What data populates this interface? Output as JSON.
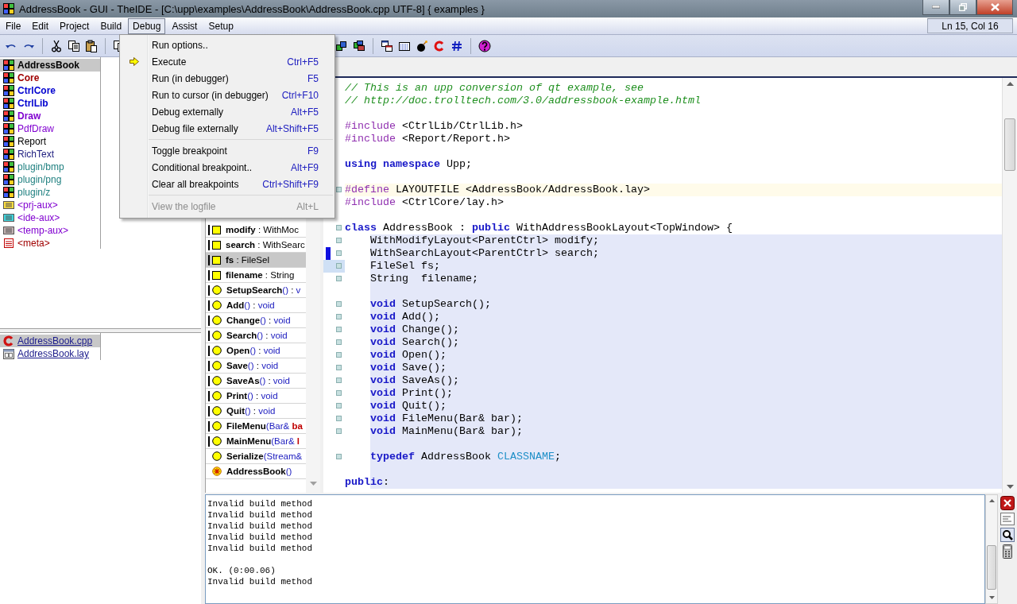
{
  "window": {
    "title": "AddressBook - GUI - TheIDE - [C:\\upp\\examples\\AddressBook\\AddressBook.cpp UTF-8] { examples }"
  },
  "menu_bar": [
    {
      "label": "File",
      "selected": false
    },
    {
      "label": "Edit",
      "selected": false
    },
    {
      "label": "Project",
      "selected": false
    },
    {
      "label": "Build",
      "selected": false
    },
    {
      "label": "Debug",
      "selected": true
    },
    {
      "label": "Assist",
      "selected": false
    },
    {
      "label": "Setup",
      "selected": false
    }
  ],
  "cursor_position": "Ln 15, Col 16",
  "debug_menu": [
    {
      "kind": "item",
      "label": "Run options..",
      "disabled": false
    },
    {
      "kind": "icon_item",
      "label": "Execute",
      "shortcut": "Ctrl+F5",
      "disabled": false
    },
    {
      "kind": "item",
      "label": "Run (in debugger)",
      "shortcut": "F5",
      "disabled": false
    },
    {
      "kind": "item",
      "label": "Run to cursor (in debugger)",
      "shortcut": "Ctrl+F10",
      "disabled": false
    },
    {
      "kind": "item",
      "label": "Debug externally",
      "shortcut": "Alt+F5",
      "disabled": false
    },
    {
      "kind": "item",
      "label": "Debug file externally",
      "shortcut": "Alt+Shift+F5",
      "disabled": false
    },
    {
      "kind": "separator"
    },
    {
      "kind": "item",
      "label": "Toggle breakpoint",
      "shortcut": "F9",
      "disabled": false
    },
    {
      "kind": "item",
      "label": "Conditional breakpoint..",
      "shortcut": "Alt+F9",
      "disabled": false
    },
    {
      "kind": "item",
      "label": "Clear all breakpoints",
      "shortcut": "Ctrl+Shift+F9",
      "disabled": false
    },
    {
      "kind": "separator"
    },
    {
      "kind": "item",
      "label": "View the logfile",
      "shortcut": "Alt+L",
      "disabled": true
    }
  ],
  "packages": [
    {
      "name": "AddressBook",
      "kind": "package",
      "bold": true,
      "color": "#000000",
      "selected": true
    },
    {
      "name": "Core",
      "kind": "package",
      "bold": true,
      "color": "#a00000",
      "selected": false
    },
    {
      "name": "CtrlCore",
      "kind": "package",
      "bold": true,
      "color": "#0000d0",
      "selected": false
    },
    {
      "name": "CtrlLib",
      "kind": "package",
      "bold": true,
      "color": "#0000d0",
      "selected": false
    },
    {
      "name": "Draw",
      "kind": "package",
      "bold": true,
      "color": "#8000d0",
      "selected": false
    },
    {
      "name": "PdfDraw",
      "kind": "package",
      "bold": false,
      "color": "#8000d0",
      "selected": false
    },
    {
      "name": "Report",
      "kind": "package",
      "bold": false,
      "color": "#000000",
      "selected": false
    },
    {
      "name": "RichText",
      "kind": "package",
      "bold": false,
      "color": "#202080",
      "selected": false
    },
    {
      "name": "plugin/bmp",
      "kind": "package",
      "bold": false,
      "color": "#208080",
      "selected": false
    },
    {
      "name": "plugin/png",
      "kind": "package",
      "bold": false,
      "color": "#208080",
      "selected": false
    },
    {
      "name": "plugin/z",
      "kind": "package",
      "bold": false,
      "color": "#208080",
      "selected": false
    },
    {
      "name": "<prj-aux>",
      "kind": "prj-aux",
      "bold": false,
      "color": "#8000d0",
      "selected": false
    },
    {
      "name": "<ide-aux>",
      "kind": "ide-aux",
      "bold": false,
      "color": "#8000d0",
      "selected": false
    },
    {
      "name": "<temp-aux>",
      "kind": "temp-aux",
      "bold": false,
      "color": "#8000d0",
      "selected": false
    },
    {
      "name": "<meta>",
      "kind": "meta",
      "bold": false,
      "color": "#a00000",
      "selected": false
    }
  ],
  "files": [
    {
      "name": "AddressBook.cpp",
      "kind": "cpp",
      "selected": true
    },
    {
      "name": "AddressBook.lay",
      "kind": "lay",
      "selected": false
    }
  ],
  "navigator": [
    {
      "kind": "variable",
      "bar": true,
      "selected": false,
      "segments": [
        {
          "text": "modify",
          "kind": "name"
        },
        {
          "text": " : WithMoc",
          "kind": "plain"
        }
      ]
    },
    {
      "kind": "variable",
      "bar": true,
      "selected": false,
      "segments": [
        {
          "text": "search",
          "kind": "name"
        },
        {
          "text": " : WithSearc",
          "kind": "plain"
        }
      ]
    },
    {
      "kind": "variable",
      "bar": true,
      "selected": true,
      "segments": [
        {
          "text": "fs",
          "kind": "name"
        },
        {
          "text": " : FileSel",
          "kind": "plain"
        }
      ]
    },
    {
      "kind": "variable",
      "bar": true,
      "selected": false,
      "segments": [
        {
          "text": "filename",
          "kind": "name"
        },
        {
          "text": " : String",
          "kind": "plain"
        }
      ]
    },
    {
      "kind": "function",
      "bar": true,
      "selected": false,
      "segments": [
        {
          "text": "SetupSearch",
          "kind": "name"
        },
        {
          "text": "()",
          "kind": "sig"
        },
        {
          "text": " : ",
          "kind": "plain"
        },
        {
          "text": "v",
          "kind": "sig"
        }
      ]
    },
    {
      "kind": "function",
      "bar": true,
      "selected": false,
      "segments": [
        {
          "text": "Add",
          "kind": "name"
        },
        {
          "text": "()",
          "kind": "sig"
        },
        {
          "text": " : ",
          "kind": "plain"
        },
        {
          "text": "void",
          "kind": "sig"
        }
      ]
    },
    {
      "kind": "function",
      "bar": true,
      "selected": false,
      "segments": [
        {
          "text": "Change",
          "kind": "name"
        },
        {
          "text": "()",
          "kind": "sig"
        },
        {
          "text": " : ",
          "kind": "plain"
        },
        {
          "text": "void",
          "kind": "sig"
        }
      ]
    },
    {
      "kind": "function",
      "bar": true,
      "selected": false,
      "segments": [
        {
          "text": "Search",
          "kind": "name"
        },
        {
          "text": "()",
          "kind": "sig"
        },
        {
          "text": " : ",
          "kind": "plain"
        },
        {
          "text": "void",
          "kind": "sig"
        }
      ]
    },
    {
      "kind": "function",
      "bar": true,
      "selected": false,
      "segments": [
        {
          "text": "Open",
          "kind": "name"
        },
        {
          "text": "()",
          "kind": "sig"
        },
        {
          "text": " : ",
          "kind": "plain"
        },
        {
          "text": "void",
          "kind": "sig"
        }
      ]
    },
    {
      "kind": "function",
      "bar": true,
      "selected": false,
      "segments": [
        {
          "text": "Save",
          "kind": "name"
        },
        {
          "text": "()",
          "kind": "sig"
        },
        {
          "text": " : ",
          "kind": "plain"
        },
        {
          "text": "void",
          "kind": "sig"
        }
      ]
    },
    {
      "kind": "function",
      "bar": true,
      "selected": false,
      "segments": [
        {
          "text": "SaveAs",
          "kind": "name"
        },
        {
          "text": "()",
          "kind": "sig"
        },
        {
          "text": " : ",
          "kind": "plain"
        },
        {
          "text": "void",
          "kind": "sig"
        }
      ]
    },
    {
      "kind": "function",
      "bar": true,
      "selected": false,
      "segments": [
        {
          "text": "Print",
          "kind": "name"
        },
        {
          "text": "()",
          "kind": "sig"
        },
        {
          "text": " : ",
          "kind": "plain"
        },
        {
          "text": "void",
          "kind": "sig"
        }
      ]
    },
    {
      "kind": "function",
      "bar": true,
      "selected": false,
      "segments": [
        {
          "text": "Quit",
          "kind": "name"
        },
        {
          "text": "()",
          "kind": "sig"
        },
        {
          "text": " : ",
          "kind": "plain"
        },
        {
          "text": "void",
          "kind": "sig"
        }
      ]
    },
    {
      "kind": "function",
      "bar": true,
      "selected": false,
      "segments": [
        {
          "text": "FileMenu",
          "kind": "name"
        },
        {
          "text": "(Bar& ",
          "kind": "sig"
        },
        {
          "text": "ba",
          "kind": "arg"
        }
      ]
    },
    {
      "kind": "function",
      "bar": true,
      "selected": false,
      "segments": [
        {
          "text": "MainMenu",
          "kind": "name"
        },
        {
          "text": "(Bar& ",
          "kind": "sig"
        },
        {
          "text": "l",
          "kind": "arg"
        }
      ]
    },
    {
      "kind": "function",
      "bar": false,
      "selected": false,
      "segments": [
        {
          "text": "Serialize",
          "kind": "name"
        },
        {
          "text": "(Stream&",
          "kind": "sig"
        }
      ]
    },
    {
      "kind": "constructor",
      "bar": false,
      "selected": false,
      "segments": [
        {
          "text": "AddressBook",
          "kind": "name"
        },
        {
          "text": "()",
          "kind": "sig"
        }
      ]
    }
  ],
  "editor": {
    "lines": [
      {
        "kind": "plain",
        "fold": false,
        "scope": false,
        "tokens": [
          {
            "text": "// This is an upp conversion of qt example, see",
            "kind": "comment"
          }
        ]
      },
      {
        "kind": "plain",
        "fold": false,
        "scope": false,
        "tokens": [
          {
            "text": "// http://doc.trolltech.com/3.0/addressbook-example.html",
            "kind": "comment"
          }
        ]
      },
      {
        "kind": "plain",
        "fold": false,
        "scope": false
      },
      {
        "kind": "plain",
        "fold": false,
        "scope": false,
        "tokens": [
          {
            "text": "#include",
            "kind": "preproc"
          },
          {
            "text": " <CtrlLib/CtrlLib.h>",
            "kind": "plain"
          }
        ]
      },
      {
        "kind": "plain",
        "fold": false,
        "scope": false,
        "tokens": [
          {
            "text": "#include",
            "kind": "preproc"
          },
          {
            "text": " <Report/Report.h>",
            "kind": "plain"
          }
        ]
      },
      {
        "kind": "plain",
        "fold": false,
        "scope": false
      },
      {
        "kind": "plain",
        "fold": false,
        "scope": false,
        "tokens": [
          {
            "text": "using namespace",
            "kind": "keyword"
          },
          {
            "text": " Upp;",
            "kind": "plain"
          }
        ]
      },
      {
        "kind": "plain",
        "fold": false,
        "scope": false
      },
      {
        "kind": "highlighted",
        "fold": true,
        "scope": false,
        "tokens": [
          {
            "text": "#define",
            "kind": "preproc"
          },
          {
            "text": " LAYOUTFILE <AddressBook/AddressBook.lay>",
            "kind": "plain"
          }
        ]
      },
      {
        "kind": "plain",
        "fold": false,
        "scope": false,
        "tokens": [
          {
            "text": "#include",
            "kind": "preproc"
          },
          {
            "text": " <CtrlCore/lay.h>",
            "kind": "plain"
          }
        ]
      },
      {
        "kind": "plain",
        "fold": false,
        "scope": false
      },
      {
        "kind": "plain",
        "fold": true,
        "scope": false,
        "tokens": [
          {
            "text": "class",
            "kind": "keyword"
          },
          {
            "text": " AddressBook : ",
            "kind": "plain"
          },
          {
            "text": "public",
            "kind": "keyword"
          },
          {
            "text": " WithAddressBookLayout<TopWindow> {",
            "kind": "plain"
          }
        ]
      },
      {
        "kind": "plain",
        "fold": true,
        "scope": true,
        "tokens": [
          {
            "text": "    WithModifyLayout<ParentCtrl> modify;",
            "kind": "plain"
          }
        ]
      },
      {
        "kind": "changed",
        "fold": true,
        "scope": true,
        "tokens": [
          {
            "text": "    WithSearchLayout<ParentCtrl> search;",
            "kind": "plain"
          }
        ]
      },
      {
        "kind": "current",
        "fold": true,
        "scope": true,
        "tokens": [
          {
            "text": "    FileSel fs;",
            "kind": "plain"
          }
        ]
      },
      {
        "kind": "plain",
        "fold": true,
        "scope": true,
        "tokens": [
          {
            "text": "    String  filename;",
            "kind": "plain"
          }
        ]
      },
      {
        "kind": "plain",
        "fold": false,
        "scope": true
      },
      {
        "kind": "plain",
        "fold": true,
        "scope": true,
        "tokens": [
          {
            "text": "    void",
            "kind": "keyword"
          },
          {
            "text": " SetupSearch();",
            "kind": "plain"
          }
        ]
      },
      {
        "kind": "plain",
        "fold": true,
        "scope": true,
        "tokens": [
          {
            "text": "    void",
            "kind": "keyword"
          },
          {
            "text": " Add();",
            "kind": "plain"
          }
        ]
      },
      {
        "kind": "plain",
        "fold": true,
        "scope": true,
        "tokens": [
          {
            "text": "    void",
            "kind": "keyword"
          },
          {
            "text": " Change();",
            "kind": "plain"
          }
        ]
      },
      {
        "kind": "plain",
        "fold": true,
        "scope": true,
        "tokens": [
          {
            "text": "    void",
            "kind": "keyword"
          },
          {
            "text": " Search();",
            "kind": "plain"
          }
        ]
      },
      {
        "kind": "plain",
        "fold": true,
        "scope": true,
        "tokens": [
          {
            "text": "    void",
            "kind": "keyword"
          },
          {
            "text": " Open();",
            "kind": "plain"
          }
        ]
      },
      {
        "kind": "plain",
        "fold": true,
        "scope": true,
        "tokens": [
          {
            "text": "    void",
            "kind": "keyword"
          },
          {
            "text": " Save();",
            "kind": "plain"
          }
        ]
      },
      {
        "kind": "plain",
        "fold": true,
        "scope": true,
        "tokens": [
          {
            "text": "    void",
            "kind": "keyword"
          },
          {
            "text": " SaveAs();",
            "kind": "plain"
          }
        ]
      },
      {
        "kind": "plain",
        "fold": true,
        "scope": true,
        "tokens": [
          {
            "text": "    void",
            "kind": "keyword"
          },
          {
            "text": " Print();",
            "kind": "plain"
          }
        ]
      },
      {
        "kind": "plain",
        "fold": true,
        "scope": true,
        "tokens": [
          {
            "text": "    void",
            "kind": "keyword"
          },
          {
            "text": " Quit();",
            "kind": "plain"
          }
        ]
      },
      {
        "kind": "plain",
        "fold": true,
        "scope": true,
        "tokens": [
          {
            "text": "    void",
            "kind": "keyword"
          },
          {
            "text": " FileMenu(Bar& bar);",
            "kind": "plain"
          }
        ]
      },
      {
        "kind": "plain",
        "fold": true,
        "scope": true,
        "tokens": [
          {
            "text": "    void",
            "kind": "keyword"
          },
          {
            "text": " MainMenu(Bar& bar);",
            "kind": "plain"
          }
        ]
      },
      {
        "kind": "plain",
        "fold": false,
        "scope": true
      },
      {
        "kind": "plain",
        "fold": true,
        "scope": true,
        "tokens": [
          {
            "text": "    typedef",
            "kind": "keyword"
          },
          {
            "text": " AddressBook ",
            "kind": "plain"
          },
          {
            "text": "CLASSNAME",
            "kind": "const"
          },
          {
            "text": ";",
            "kind": "plain"
          }
        ]
      },
      {
        "kind": "plain",
        "fold": false,
        "scope": true
      },
      {
        "kind": "plain",
        "fold": false,
        "scope": true,
        "tokens": [
          {
            "text": "public",
            "kind": "keyword"
          },
          {
            "text": ":",
            "kind": "plain"
          }
        ]
      }
    ]
  },
  "console": {
    "groups": [
      [
        "Invalid build method",
        "Invalid build method",
        "Invalid build method",
        "Invalid build method",
        "Invalid build method"
      ],
      [
        "OK. (0:00.06)",
        "Invalid build method"
      ]
    ]
  }
}
